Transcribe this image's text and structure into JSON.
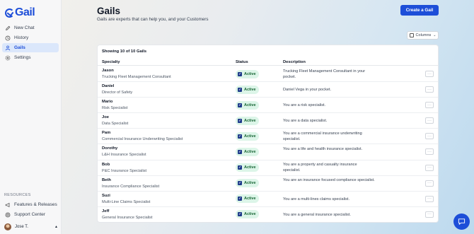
{
  "brand": {
    "name": "Gail"
  },
  "sidebar": {
    "items": [
      {
        "label": "New Chat",
        "icon": "edit-icon"
      },
      {
        "label": "History",
        "icon": "history-icon"
      },
      {
        "label": "Gails",
        "icon": "gails-icon",
        "active": true
      },
      {
        "label": "Settings",
        "icon": "gear-icon"
      }
    ],
    "resources_title": "RESOURCES",
    "resources": [
      {
        "label": "Features & Releases",
        "icon": "megaphone-icon"
      },
      {
        "label": "Support Center",
        "icon": "help-icon"
      }
    ],
    "user": {
      "name": "Jose T."
    }
  },
  "header": {
    "title": "Gails",
    "subtitle": "Gails are experts that can help you, and your Customers",
    "create_label": "Create a Gail",
    "columns_label": "Columns"
  },
  "table": {
    "showing": "Showing 10 of 10 Gails",
    "columns": [
      "Specialty",
      "Status",
      "Description"
    ],
    "rows": [
      {
        "name": "Jason",
        "role": "Trucking Fleet Management Consultant",
        "status": "Active",
        "description": "Trucking Fleet Management Consultant in your pocket."
      },
      {
        "name": "Daniel",
        "role": "Director of Safety",
        "status": "Active",
        "description": "Daniel Vega in your pocket."
      },
      {
        "name": "Mario",
        "role": "Risk Specialist",
        "status": "Active",
        "description": "You are a risk specialist."
      },
      {
        "name": "Joe",
        "role": "Data Specialist",
        "status": "Active",
        "description": "You are a data specialist."
      },
      {
        "name": "Pam",
        "role": "Commercial Insurance Underwriting Specialist",
        "status": "Active",
        "description": "You are a commercial insurance underwriting specialist."
      },
      {
        "name": "Dorothy",
        "role": "L&H Insurance Specialist",
        "status": "Active",
        "description": "You are a life and health insurance specialist."
      },
      {
        "name": "Bob",
        "role": "P&C Insurance Specialist",
        "status": "Active",
        "description": "You are a property and casualty insurance specialist."
      },
      {
        "name": "Beth",
        "role": "Insurance Compliance Specialist",
        "status": "Active",
        "description": "You are an insurance focused compliance specialist."
      },
      {
        "name": "Suzi",
        "role": "Multi-Line Claims Specialist",
        "status": "Active",
        "description": "You are a multi-lines claims specialist."
      },
      {
        "name": "Jeff",
        "role": "General Insurance Specialist",
        "status": "Active",
        "description": "You are a general insurance specialist."
      }
    ]
  },
  "colors": {
    "accent": "#1d4ed8",
    "active_badge_bg": "#dcf5e8",
    "active_badge_text": "#166534"
  }
}
